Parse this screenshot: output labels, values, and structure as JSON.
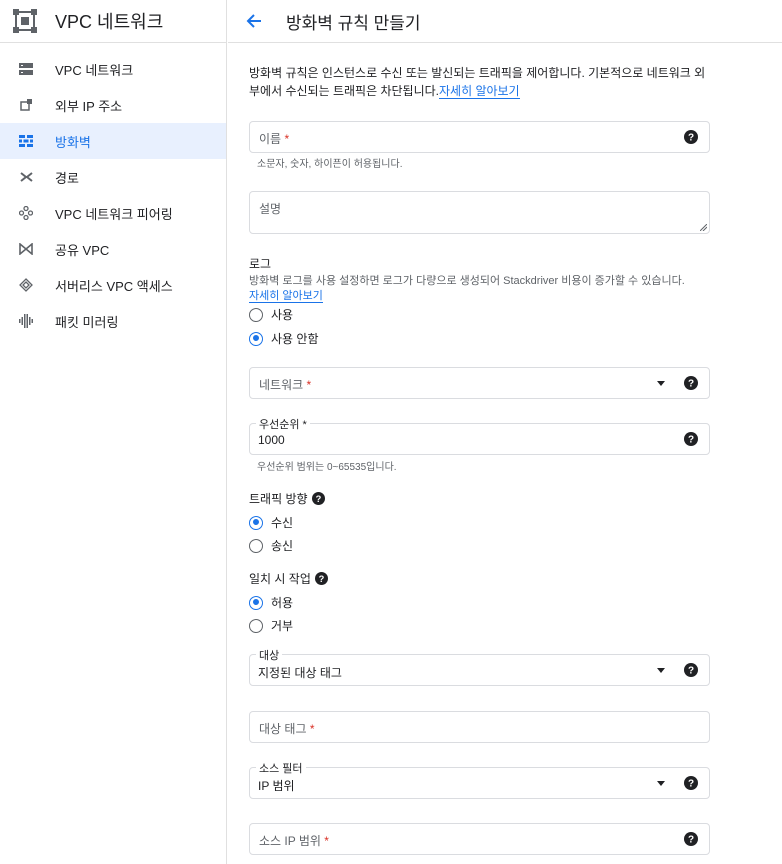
{
  "app": {
    "title": "VPC 네트워크"
  },
  "sidebar": {
    "items": [
      {
        "label": "VPC 네트워크",
        "icon": "vpc-network-icon"
      },
      {
        "label": "외부 IP 주소",
        "icon": "external-ip-icon"
      },
      {
        "label": "방화벽",
        "icon": "firewall-icon",
        "active": true
      },
      {
        "label": "경로",
        "icon": "routes-icon"
      },
      {
        "label": "VPC 네트워크 피어링",
        "icon": "peering-icon"
      },
      {
        "label": "공유 VPC",
        "icon": "shared-vpc-icon"
      },
      {
        "label": "서버리스 VPC 액세스",
        "icon": "serverless-icon"
      },
      {
        "label": "패킷 미러링",
        "icon": "packet-mirroring-icon"
      }
    ]
  },
  "header": {
    "title": "방화벽 규칙 만들기"
  },
  "intro": {
    "text": "방화벽 규칙은 인스턴스로 수신 또는 발신되는 트래픽을 제어합니다. 기본적으로 네트워크 외부에서 수신되는 트래픽은 차단됩니다.",
    "link": "자세히 알아보기"
  },
  "form": {
    "name": {
      "placeholder": "이름",
      "hint": "소문자, 숫자, 하이픈이 허용됩니다."
    },
    "description": {
      "placeholder": "설명"
    },
    "logs": {
      "title": "로그",
      "desc": "방화벽 로그를 사용 설정하면 로그가 다량으로 생성되어 Stackdriver 비용이 증가할 수 있습니다.",
      "link": "자세히 알아보기",
      "options": [
        "사용",
        "사용 안함"
      ],
      "selected": "사용 안함"
    },
    "network": {
      "placeholder": "네트워크"
    },
    "priority": {
      "label": "우선순위",
      "value": "1000",
      "hint": "우선순위 범위는 0~65535입니다."
    },
    "direction": {
      "title": "트래픽 방향",
      "options": [
        "수신",
        "송신"
      ],
      "selected": "수신"
    },
    "action": {
      "title": "일치 시 작업",
      "options": [
        "허용",
        "거부"
      ],
      "selected": "허용"
    },
    "targets": {
      "label": "대상",
      "value": "지정된 대상 태그"
    },
    "target_tags": {
      "placeholder": "대상 태그"
    },
    "source_filter": {
      "label": "소스 필터",
      "value": "IP 범위"
    },
    "source_ip": {
      "placeholder": "소스 IP 범위"
    }
  },
  "colors": {
    "accent": "#1a73e8",
    "required": "#d93025"
  }
}
